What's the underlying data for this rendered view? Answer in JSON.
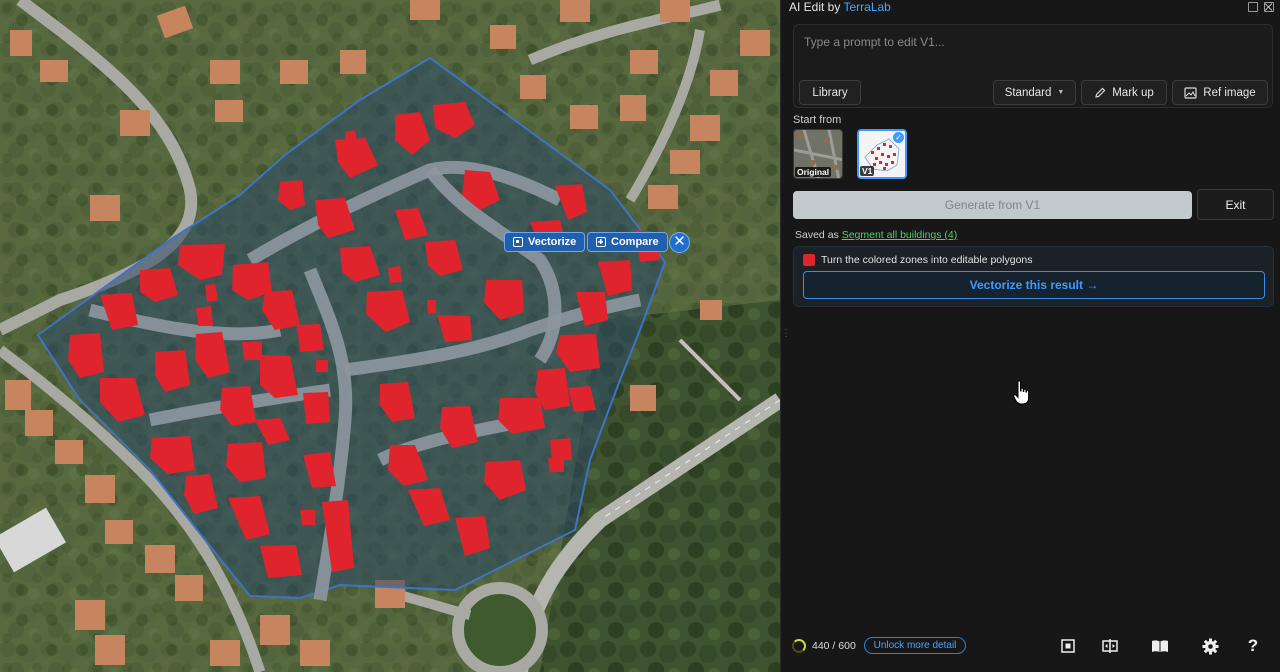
{
  "map": {
    "overlay_buttons": {
      "vectorize": "Vectorize",
      "compare": "Compare"
    }
  },
  "panel": {
    "title": "AI Edit by ",
    "brand": "TerraLab",
    "prompt_placeholder": "Type a prompt to edit V1...",
    "buttons": {
      "library": "Library",
      "standard": "Standard",
      "markup": "Mark up",
      "ref_image": "Ref image"
    },
    "start_from_label": "Start from",
    "thumbs": [
      {
        "label": "Original"
      },
      {
        "label": "V1",
        "selected": true
      }
    ],
    "generate_label": "Generate from V1",
    "exit_label": "Exit",
    "saved_prefix": "Saved as ",
    "saved_link": "Segment all buildings (4)",
    "vectorize_hint": "Turn the colored zones into editable polygons",
    "vectorize_button": "Vectorize this result →",
    "footer": {
      "credits": "440 / 600",
      "unlock": "Unlock more detail",
      "help": "?"
    }
  },
  "colors": {
    "accent": "#3d9bff",
    "segment_red": "#e0242d",
    "saved_green": "#4ed06b",
    "credit_ring": "#c8dd2a"
  }
}
